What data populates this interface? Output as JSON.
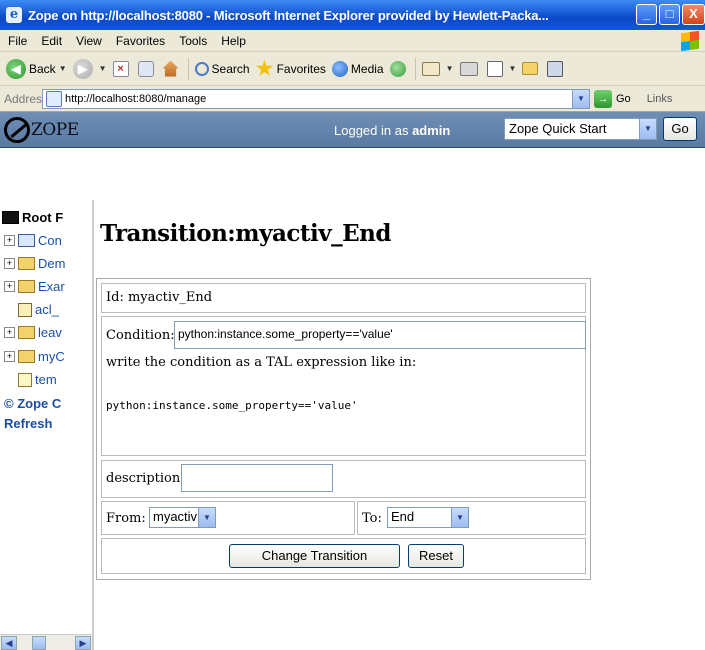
{
  "window": {
    "title": "Zope on http://localhost:8080 - Microsoft Internet Explorer provided by Hewlett-Packa...",
    "min": "_",
    "max": "□",
    "close": "X"
  },
  "menu": [
    "File",
    "Edit",
    "View",
    "Favorites",
    "Tools",
    "Help"
  ],
  "toolbar": {
    "back": "Back",
    "search": "Search",
    "favorites": "Favorites",
    "media": "Media"
  },
  "address": {
    "label": "Address",
    "url": "http://localhost:8080/manage",
    "go": "Go",
    "links": "Links"
  },
  "zope_header": {
    "logo": "ZOPE",
    "logged_prefix": "Logged in as ",
    "user": "admin",
    "quick_select": "Zope Quick Start",
    "go": "Go"
  },
  "tree": {
    "root": "Root F",
    "items": [
      "Con",
      "Dem",
      "Exar",
      "acl_",
      "leav",
      "myC",
      "tem"
    ],
    "copyright": "© Zope C",
    "refresh": "Refresh"
  },
  "page": {
    "title": "Transition:myactiv_End",
    "id_label": "Id:",
    "id_value": "myactiv_End",
    "condition_label": "Condition:",
    "condition_value": "python:instance.some_property=='value'",
    "condition_help": "write the condition as a TAL expression like in:",
    "condition_example": "python:instance.some_property=='value'",
    "description_label": "description:",
    "description_value": "",
    "from_label": "From:",
    "from_value": "myactiv",
    "to_label": "To:",
    "to_value": "End",
    "change_button": "Change Transition",
    "reset_button": "Reset"
  }
}
